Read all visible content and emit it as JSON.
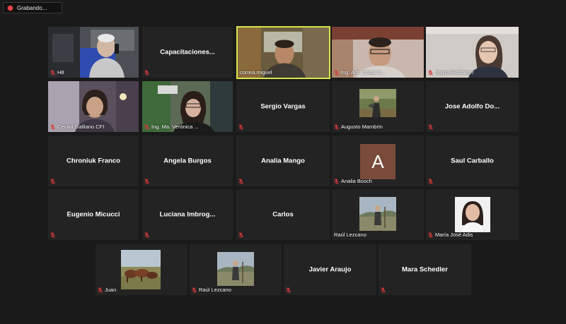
{
  "recording": {
    "label": "Grabando..."
  },
  "row1": {
    "h8": "H8",
    "capacitaciones": "Capacitaciones...",
    "correa": "correa.miguel",
    "cesar": "Ing. Agr. César A...",
    "mayra": "Mayra Rolhaiser"
  },
  "row2": {
    "cecilia": "Cecilia Galliano CFI",
    "veronica": "Ing. Ma. Verónica ...",
    "sergio": "Sergio Vargas",
    "augusto": "Augusto Mambrin",
    "jose": "Jose Adolfo Do..."
  },
  "row3": {
    "chroniuk": "Chroniuk Franco",
    "angela": "Angela Burgos",
    "analia_mango": "Analia Mango",
    "analia_bosch": "Analia Bosch",
    "analia_bosch_initial": "A",
    "saul": "Saul Carballo"
  },
  "row4": {
    "eugenio": "Eugenio Micucci",
    "luciana": "Luciana Imbrog...",
    "carlos": "Carlos",
    "raul": "Raúl Lezcano",
    "maria": "María José Adis"
  },
  "row5": {
    "juan": "Juan",
    "raul2": "Raúl Lezcano",
    "javier": "Javier Araujo",
    "mara": "Mara Schedler"
  },
  "colors": {
    "active_border": "#d7e64a",
    "mute_red": "#d83a3a",
    "tile_bg": "#232323"
  }
}
